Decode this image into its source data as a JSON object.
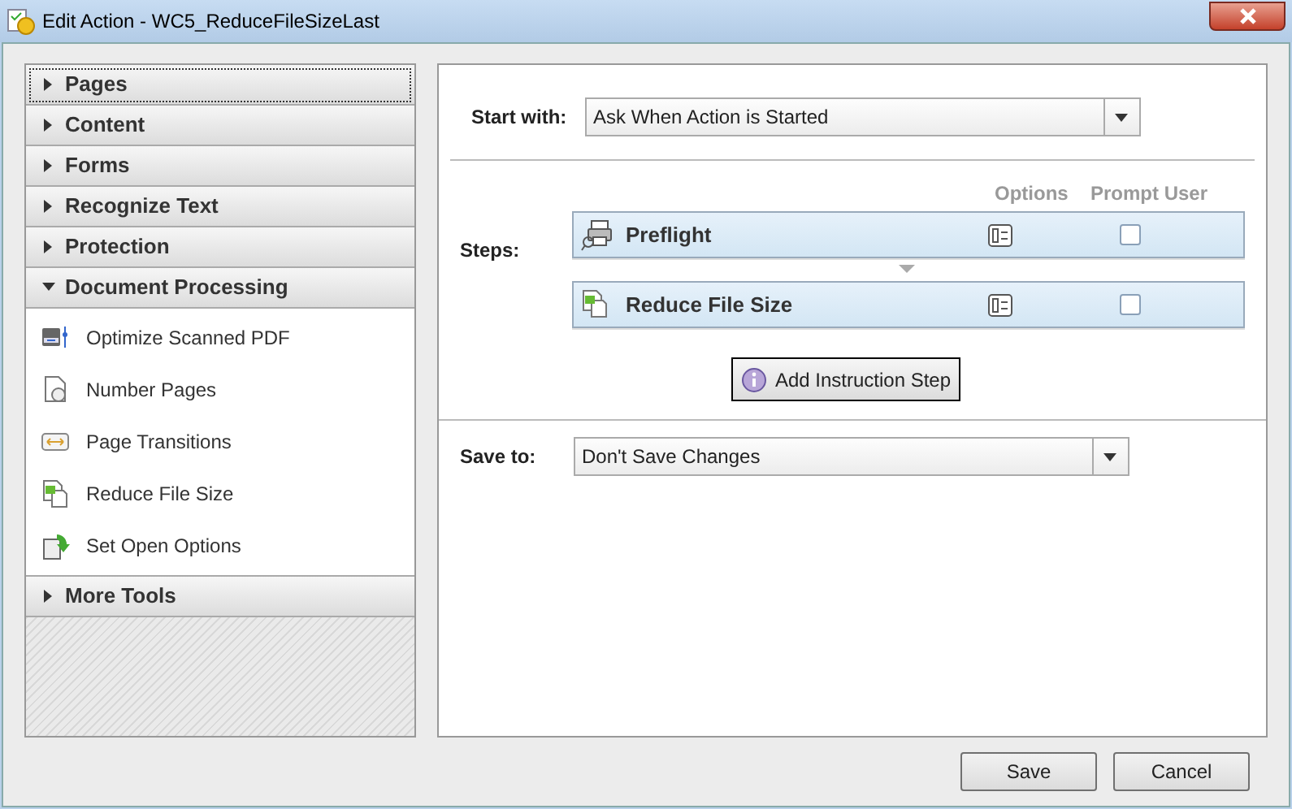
{
  "window": {
    "title": "Edit Action - WC5_ReduceFileSizeLast"
  },
  "sidebar": {
    "sections": [
      {
        "label": "Pages",
        "expanded": false,
        "focused": true
      },
      {
        "label": "Content",
        "expanded": false,
        "focused": false
      },
      {
        "label": "Forms",
        "expanded": false,
        "focused": false
      },
      {
        "label": "Recognize Text",
        "expanded": false,
        "focused": false
      },
      {
        "label": "Protection",
        "expanded": false,
        "focused": false
      },
      {
        "label": "Document Processing",
        "expanded": true,
        "focused": false,
        "items": [
          {
            "label": "Optimize Scanned PDF",
            "kind": "scanner"
          },
          {
            "label": "Number Pages",
            "kind": "number"
          },
          {
            "label": "Page Transitions",
            "kind": "transition"
          },
          {
            "label": "Reduce File Size",
            "kind": "reduce"
          },
          {
            "label": "Set Open Options",
            "kind": "open"
          }
        ]
      },
      {
        "label": "More Tools",
        "expanded": false,
        "focused": false
      }
    ]
  },
  "start_with": {
    "label": "Start with:",
    "value": "Ask When Action is Started"
  },
  "steps": {
    "label": "Steps:",
    "columns": [
      "Options",
      "Prompt User"
    ],
    "items": [
      {
        "label": "Preflight",
        "kind": "preflight",
        "prompt_user": false
      },
      {
        "label": "Reduce File Size",
        "kind": "reduce",
        "prompt_user": false
      }
    ],
    "add_button": "Add Instruction Step"
  },
  "save_to": {
    "label": "Save to:",
    "value": "Don't Save Changes"
  },
  "buttons": [
    "Save",
    "Cancel"
  ]
}
